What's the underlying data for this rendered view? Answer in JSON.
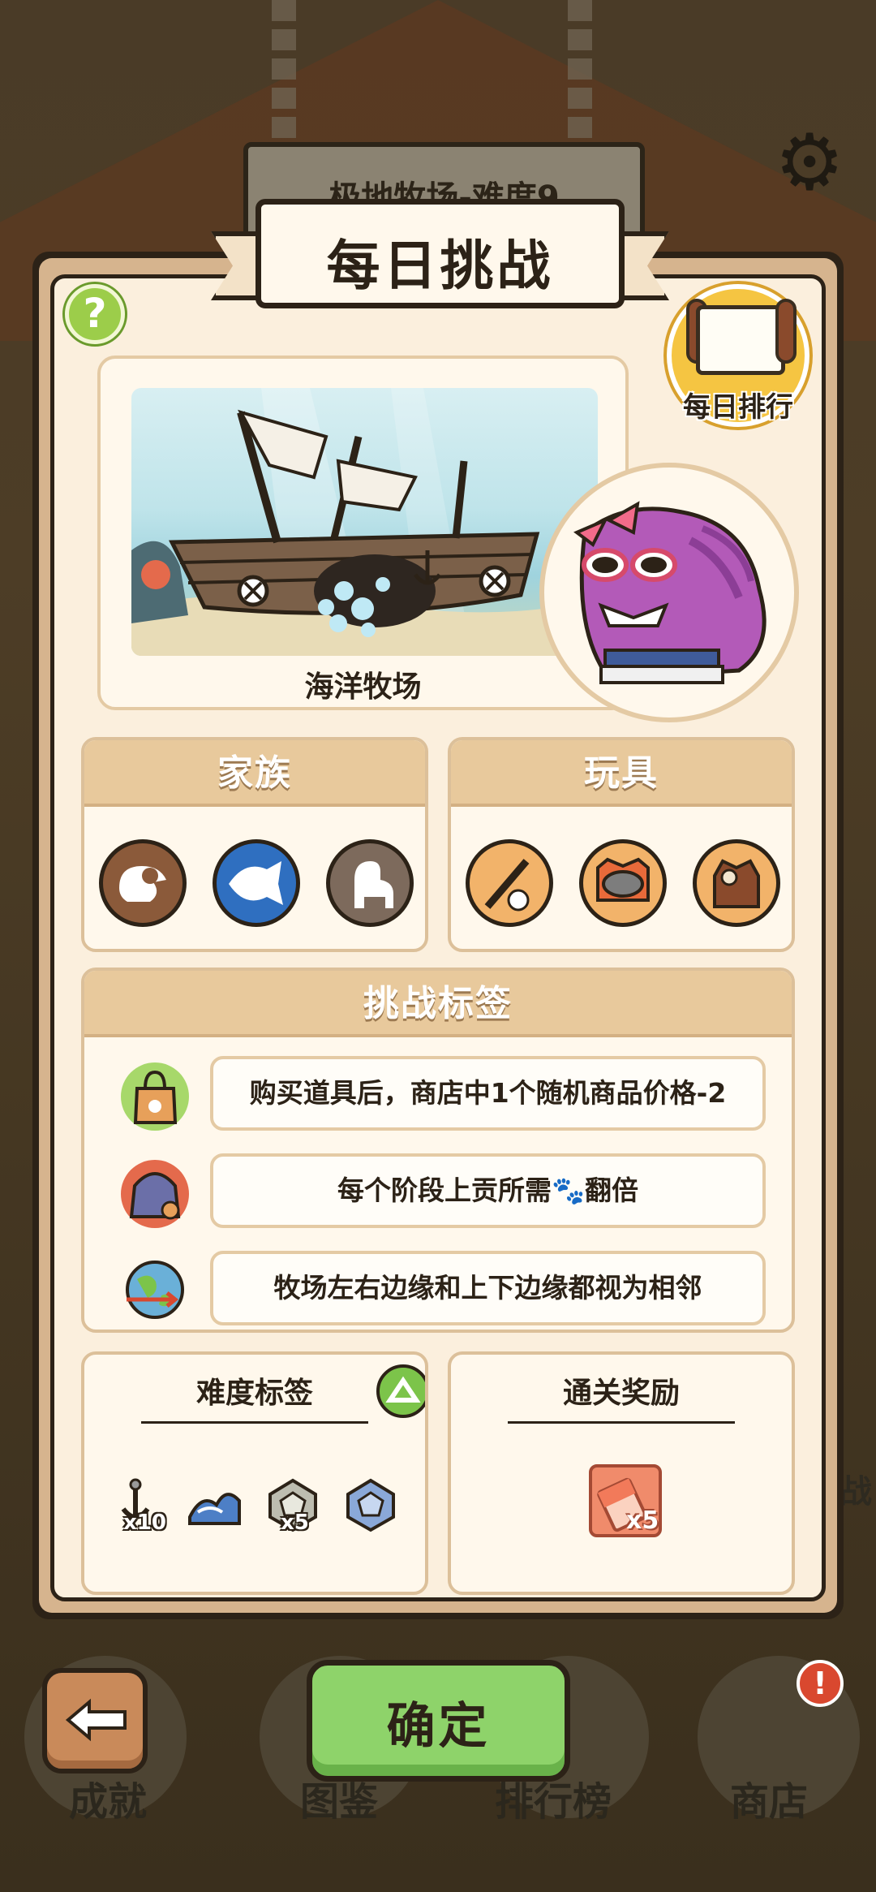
{
  "background": {
    "sign_text": "极地牧场-难度9",
    "bottom_nav": [
      "成就",
      "图鉴",
      "排行榜",
      "商店"
    ],
    "side_label": "战"
  },
  "dialog": {
    "title": "每日挑战",
    "help_symbol": "?",
    "daily_rank_label": "每日排行",
    "map_name": "海洋牧场",
    "family": {
      "heading": "家族",
      "icons": [
        "chicken-family-icon",
        "fish-family-icon",
        "alpaca-family-icon"
      ]
    },
    "toys": {
      "heading": "玩具",
      "icons": [
        "stick-toy-icon",
        "bowl-toy-icon",
        "bag-toy-icon"
      ]
    },
    "challenge_tags": {
      "heading": "挑战标签",
      "items": [
        {
          "icon": "shopping-bag-icon",
          "text": "购买道具后，商店中1个随机商品价格-2"
        },
        {
          "icon": "tribute-sack-icon",
          "text": "每个阶段上贡所需🐾翻倍"
        },
        {
          "icon": "globe-wrap-icon",
          "text": "牧场左右边缘和上下边缘都视为相邻"
        }
      ]
    },
    "difficulty_tags": {
      "heading": "难度标签",
      "items": [
        {
          "icon": "anchor-icon",
          "count": "x10"
        },
        {
          "icon": "wave-icon",
          "count": ""
        },
        {
          "icon": "dice-icon",
          "count": "x5"
        },
        {
          "icon": "blue-dice-icon",
          "count": ""
        }
      ]
    },
    "rewards": {
      "heading": "通关奖励",
      "items": [
        {
          "icon": "eraser-icon",
          "count": "x5"
        }
      ]
    },
    "confirm_label": "确定"
  },
  "notification_badge": "!",
  "colors": {
    "panel_bg": "#fbefdd",
    "section_head": "#e8c99c",
    "confirm_green": "#8ed36a",
    "help_green": "#9ccd4a",
    "rank_gold": "#f5c542",
    "outline": "#2c2217"
  }
}
